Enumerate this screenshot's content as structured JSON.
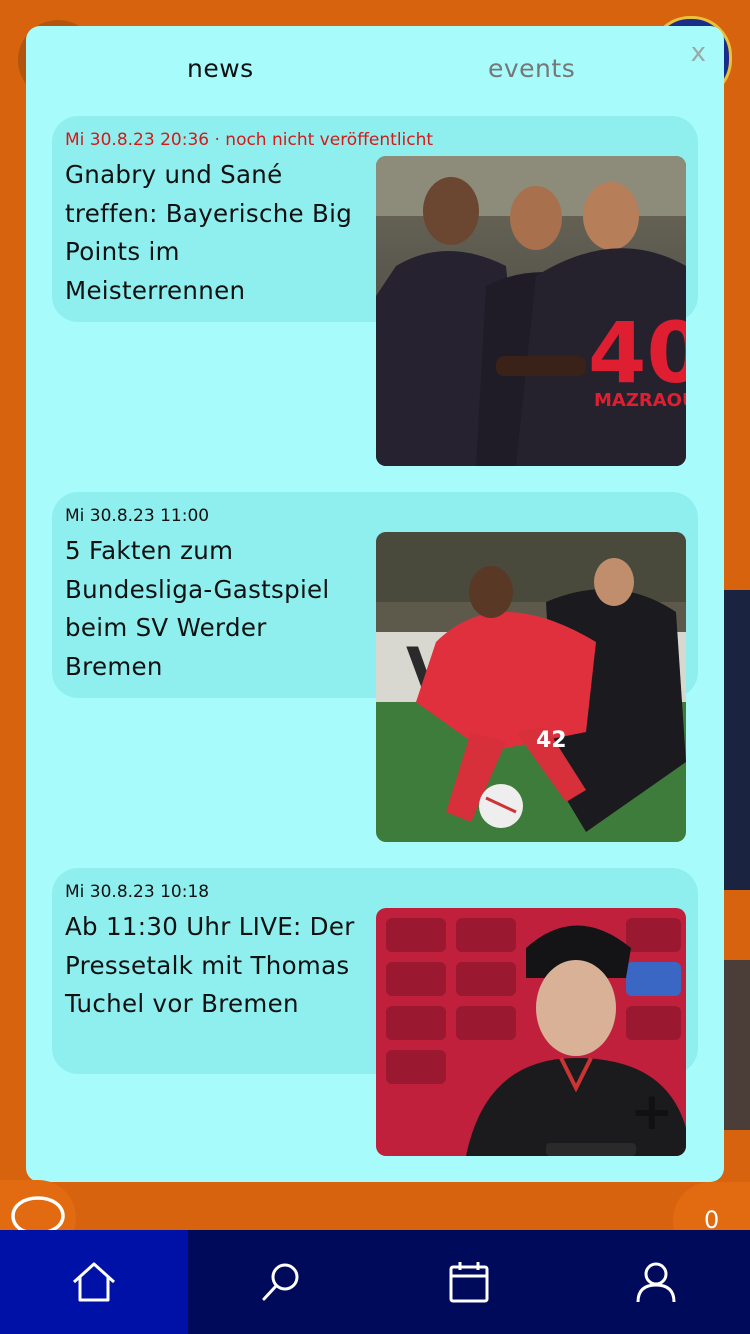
{
  "modal": {
    "close_label": "x",
    "tabs": [
      {
        "label": "news",
        "active": true
      },
      {
        "label": "events",
        "active": false
      }
    ]
  },
  "news": [
    {
      "date": "Mi 30.8.23 20:36 · noch nicht veröffentlicht",
      "unpublished": true,
      "title": "Gnabry und Sané treffen: Bayerische Big Points im Meisterrennen",
      "image": "players-celebrating-photo"
    },
    {
      "date": "Mi 30.8.23 11:00",
      "unpublished": false,
      "title": "5 Fakten zum Bundesliga-Gastspiel beim SV Werder Bremen",
      "image": "player-dribbling-photo"
    },
    {
      "date": "Mi 30.8.23 10:18",
      "unpublished": false,
      "title": "Ab 11:30 Uhr LIVE: Der Pressetalk mit Thomas Tuchel vor Bremen",
      "image": "coach-press-conference-photo"
    }
  ],
  "plus_label": "+",
  "chat_button_icon": "speech-bubble-icon",
  "counter": "0",
  "colors": {
    "background": "#d8630f",
    "modal": "#a7fcfb",
    "card": "#8feeee",
    "unpublished": "#d71818",
    "nav": "#000a5a",
    "nav_active": "#0011a8"
  },
  "bottom_nav": [
    {
      "icon": "home-icon",
      "active": true
    },
    {
      "icon": "search-icon",
      "active": false
    },
    {
      "icon": "calendar-icon",
      "active": false
    },
    {
      "icon": "profile-icon",
      "active": false
    }
  ]
}
